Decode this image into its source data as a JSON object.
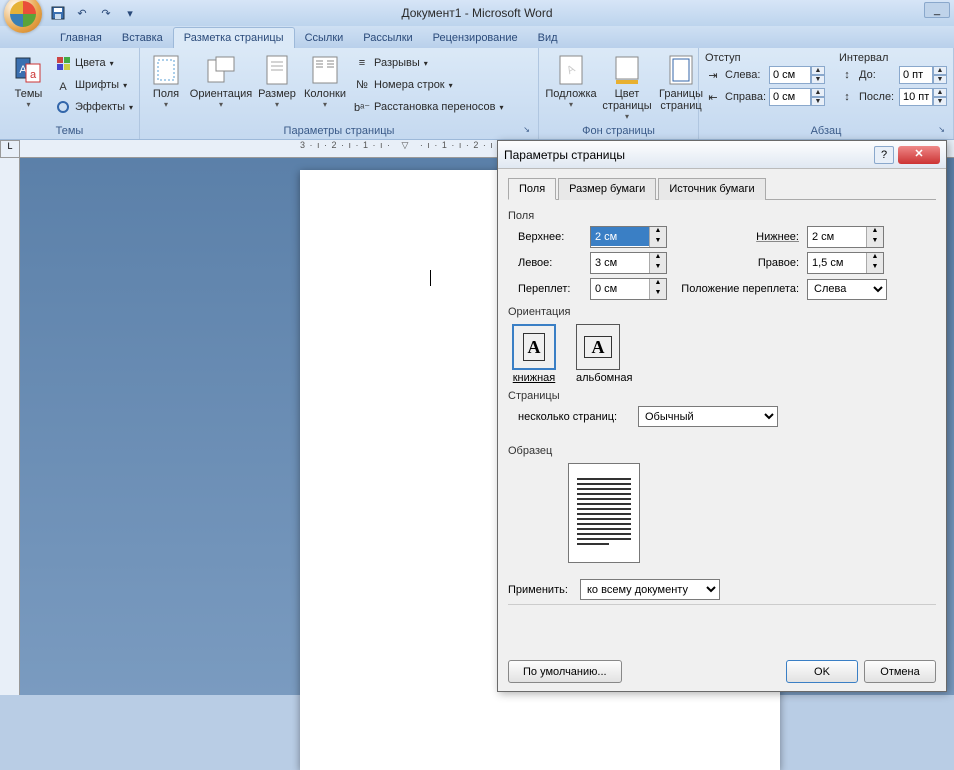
{
  "title": "Документ1 - Microsoft Word",
  "tabs": [
    "Главная",
    "Вставка",
    "Разметка страницы",
    "Ссылки",
    "Рассылки",
    "Рецензирование",
    "Вид"
  ],
  "ribbon": {
    "themes": {
      "title": "Темы",
      "btn": "Темы",
      "colors": "Цвета",
      "fonts": "Шрифты",
      "effects": "Эффекты"
    },
    "page_setup": {
      "title": "Параметры страницы",
      "margins": "Поля",
      "orientation": "Ориентация",
      "size": "Размер",
      "columns": "Колонки",
      "breaks": "Разрывы",
      "line_numbers": "Номера строк",
      "hyphenation": "Расстановка переносов"
    },
    "page_bg": {
      "title": "Фон страницы",
      "watermark": "Подложка",
      "page_color": "Цвет страницы",
      "borders": "Границы страниц"
    },
    "paragraph": {
      "title": "Абзац",
      "indent": "Отступ",
      "left": "Слева:",
      "right": "Справа:",
      "left_val": "0 см",
      "right_val": "0 см",
      "spacing": "Интервал",
      "before": "До:",
      "after": "После:",
      "before_val": "0 пт",
      "after_val": "10 пт"
    }
  },
  "dialog": {
    "title": "Параметры страницы",
    "tabs": [
      "Поля",
      "Размер бумаги",
      "Источник бумаги"
    ],
    "margins": {
      "group": "Поля",
      "top": "Верхнее:",
      "top_val": "2 см",
      "bottom": "Нижнее:",
      "bottom_val": "2 см",
      "left": "Левое:",
      "left_val": "3 см",
      "right": "Правое:",
      "right_val": "1,5 см",
      "gutter": "Переплет:",
      "gutter_val": "0 см",
      "gutter_pos": "Положение переплета:",
      "gutter_pos_val": "Слева"
    },
    "orientation": {
      "group": "Ориентация",
      "portrait": "книжная",
      "landscape": "альбомная"
    },
    "pages": {
      "group": "Страницы",
      "multiple": "несколько страниц:",
      "multiple_val": "Обычный"
    },
    "preview": {
      "group": "Образец"
    },
    "apply": {
      "label": "Применить:",
      "val": "ко всему документу"
    },
    "buttons": {
      "default": "По умолчанию...",
      "ok": "OK",
      "cancel": "Отмена"
    }
  }
}
